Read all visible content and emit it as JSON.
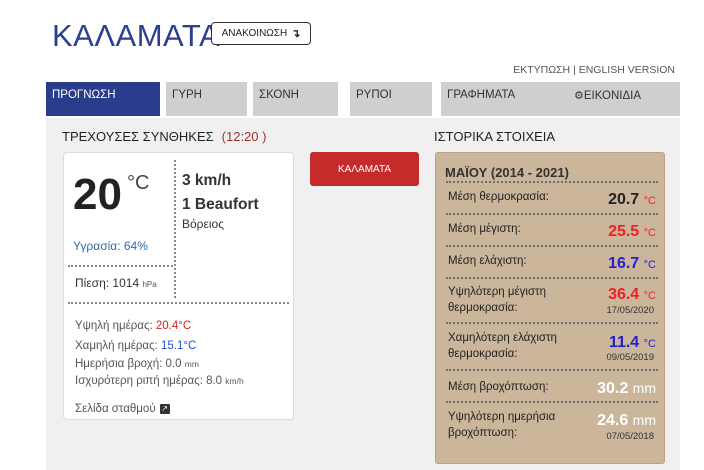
{
  "header": {
    "title": "ΚΑΛΑΜΑΤΑ",
    "announcement_label": "ΑΝΑΚΟΙΝΩΣΗ",
    "announcement_icon": "arrow-turn-down-icon"
  },
  "toplinks": {
    "print": "ΕΚΤΥΠΩΣΗ",
    "separator": "|",
    "english": "ENGLISH VERSION"
  },
  "tabs": [
    {
      "label": "ΠΡΟΓΝΩΣΗ",
      "active": true
    },
    {
      "label": "ΓΥΡΗ"
    },
    {
      "label": "ΣΚΟΝΗ"
    },
    {
      "label": "ΡΥΠΟΙ"
    },
    {
      "label": "ΓΡΑΦΗΜΑΤΑ"
    },
    {
      "label": "ΕΙΚΟΝΙΔΙΑ",
      "icon": "gear-icon"
    }
  ],
  "current": {
    "heading": "ΤΡΕΧΟΥΣΕΣ ΣΥΝΘΗΚΕΣ",
    "time": "(12:20 )",
    "temperature": "20",
    "temp_unit": "°C",
    "wind_speed": "3 km/h",
    "wind_beaufort": "1 Beaufort",
    "wind_direction": "Βόρειος",
    "humidity": "Υγρασία: 64%",
    "pressure_label": "Πίεση: 1014",
    "pressure_unit": "hPa",
    "high_label": "Υψηλή ημέρας:",
    "high_value": "20.4°C",
    "low_label": "Χαμηλή ημέρας:",
    "low_value": "15.1°C",
    "rain_label": "Ημερήσια βροχή: 0.0",
    "rain_unit": "mm",
    "gust_label": "Ισχυρότερη ριπή ημέρας: 8.0",
    "gust_unit": "km/h",
    "station_link": "Σελίδα σταθμού"
  },
  "location_button": "ΚΑΛΑΜΑΤΑ",
  "history": {
    "heading": "ΙΣΤΟΡΙΚΑ ΣΤΟΙΧΕΙΑ",
    "period": "ΜΑΪΟΥ (2014 - 2021)",
    "rows": [
      {
        "label1": "Μέση θερμοκρασία:",
        "value": "20.7",
        "unit": "°C"
      },
      {
        "label1": "Μέση μέγιστη:",
        "value": "25.5",
        "unit": "°C"
      },
      {
        "label1": "Μέση ελάχιστη:",
        "value": "16.7",
        "unit": "°C"
      },
      {
        "label1": "Υψηλότερη μέγιστη",
        "label2": "θερμοκρασία:",
        "value": "36.4",
        "unit": "°C",
        "date": "17/05/2020"
      },
      {
        "label1": "Χαμηλότερη ελάχιστη",
        "label2": "θερμοκρασία:",
        "value": "11.4",
        "unit": "°C",
        "date": "09/05/2019"
      },
      {
        "label1": "Μέση βροχόπτωση:",
        "value": "30.2",
        "unit": "mm"
      },
      {
        "label1": "Υψηλότερη ημερήσια",
        "label2": "βροχόπτωση:",
        "value": "24.6",
        "unit": "mm",
        "date": "07/05/2018"
      }
    ]
  },
  "colors": {
    "brand_blue": "#2a3d8c",
    "alert_red": "#c62b2b",
    "history_bg": "#cbb59b"
  }
}
